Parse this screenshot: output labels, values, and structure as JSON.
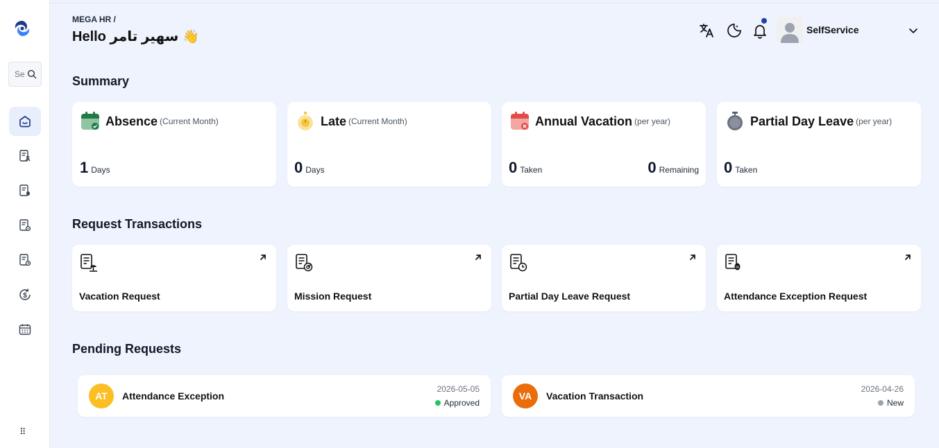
{
  "header": {
    "breadcrumb": "MEGA HR /",
    "greeting": "Hello سهير تامر",
    "wave_emoji": "👋",
    "user_name": "SelfService",
    "icons": [
      "translate-icon",
      "dark-mode-icon",
      "bell-icon",
      "user-avatar",
      "chevron-down-icon"
    ]
  },
  "sidebar": {
    "search_placeholder": "Search",
    "items": [
      {
        "icon": "home-icon",
        "active": true
      },
      {
        "icon": "vacation-doc-icon",
        "active": false
      },
      {
        "icon": "mission-doc-icon",
        "active": false
      },
      {
        "icon": "doc-gear-icon",
        "active": false
      },
      {
        "icon": "doc-clock-icon",
        "active": false
      },
      {
        "icon": "dollar-refresh-icon",
        "active": false
      },
      {
        "icon": "calendar-icon",
        "active": false
      }
    ]
  },
  "summary": {
    "title": "Summary",
    "cards": [
      {
        "title": "Absence",
        "subtitle": "(Current Month)",
        "values": [
          {
            "value": "1",
            "unit": "Days"
          }
        ],
        "icon": "calendar-check-icon",
        "color": "#2e8b57"
      },
      {
        "title": "Late",
        "subtitle": "(Current Month)",
        "values": [
          {
            "value": "0",
            "unit": "Days"
          }
        ],
        "icon": "stopwatch-icon",
        "color": "#f5c542"
      },
      {
        "title": "Annual Vacation",
        "subtitle": "(per year)",
        "values": [
          {
            "value": "0",
            "unit": "Taken"
          },
          {
            "value": "0",
            "unit": "Remaining"
          }
        ],
        "icon": "calendar-x-icon",
        "color": "#e24b4b"
      },
      {
        "title": "Partial Day Leave",
        "subtitle": "(per year)",
        "values": [
          {
            "value": "0",
            "unit": "Taken"
          }
        ],
        "icon": "timer-icon",
        "color": "#5b6170"
      }
    ]
  },
  "requests": {
    "title": "Request Transactions",
    "items": [
      {
        "label": "Vacation Request",
        "icon": "vacation-doc-icon"
      },
      {
        "label": "Mission Request",
        "icon": "mission-doc-icon"
      },
      {
        "label": "Partial Day Leave Request",
        "icon": "partial-leave-doc-icon"
      },
      {
        "label": "Attendance Exception Request",
        "icon": "attendance-doc-icon"
      }
    ]
  },
  "pending": {
    "title": "Pending Requests",
    "items": [
      {
        "initials": "AT",
        "title": "Attendance Exception",
        "date": "2026-05-05",
        "status": "Approved",
        "avatar_color": "#fbbf24",
        "status_color": "#22c55e"
      },
      {
        "initials": "VA",
        "title": "Vacation Transaction",
        "date": "2026-04-26",
        "status": "New",
        "avatar_color": "#ea6c0a",
        "status_color": "#9ca3af"
      }
    ]
  }
}
